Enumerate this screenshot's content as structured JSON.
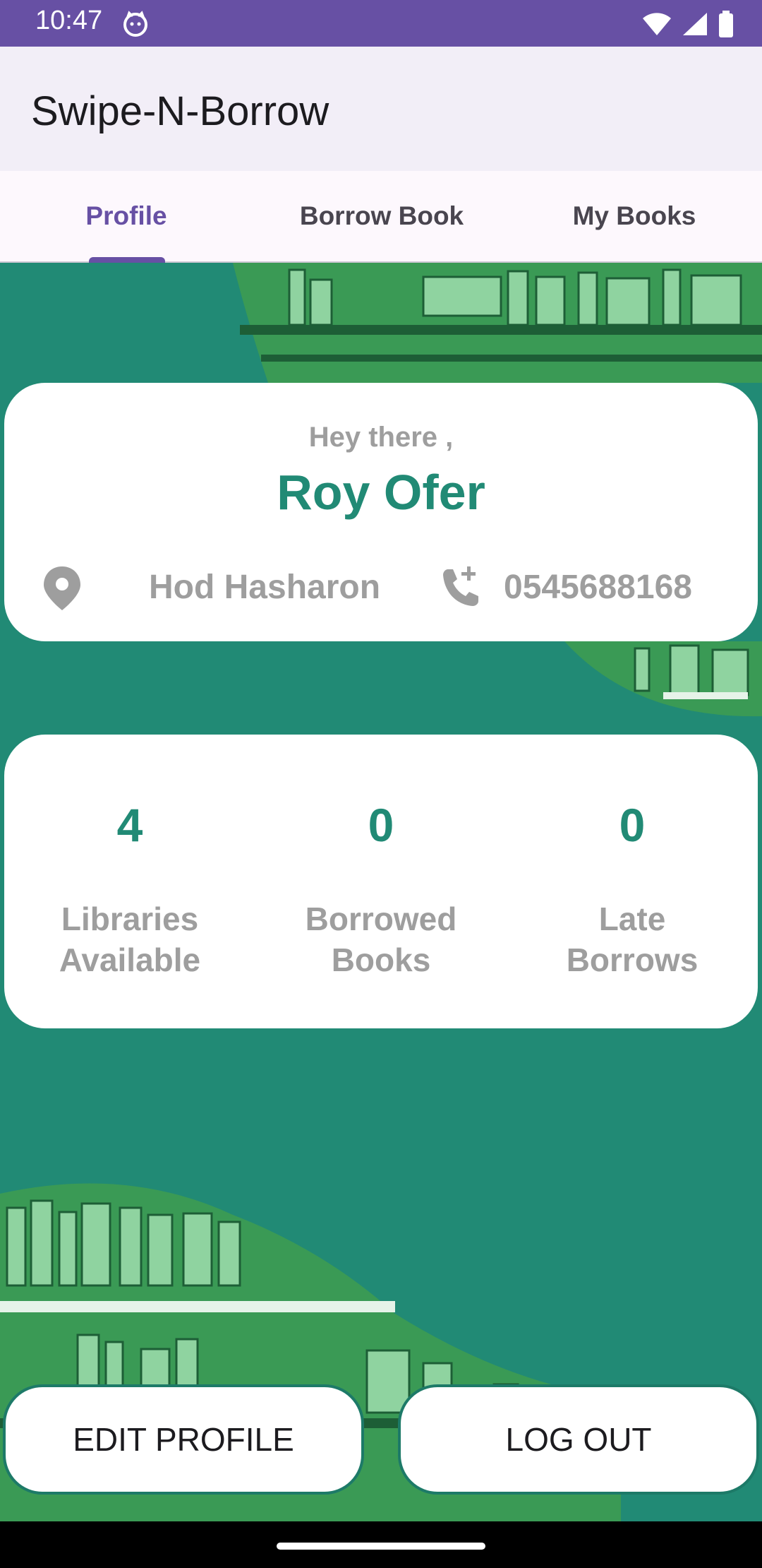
{
  "status_bar": {
    "time": "10:47"
  },
  "app_bar": {
    "title": "Swipe-N-Borrow"
  },
  "tabs": [
    {
      "label": "Profile",
      "active": true
    },
    {
      "label": "Borrow Book",
      "active": false
    },
    {
      "label": "My Books",
      "active": false
    }
  ],
  "profile": {
    "greeting": "Hey there ,",
    "name": "Roy Ofer",
    "location": "Hod Hasharon",
    "phone": "0545688168"
  },
  "stats": [
    {
      "value": "4",
      "label_line1": "Libraries",
      "label_line2": "Available"
    },
    {
      "value": "0",
      "label_line1": "Borrowed",
      "label_line2": "Books"
    },
    {
      "value": "0",
      "label_line1": "Late",
      "label_line2": "Borrows"
    }
  ],
  "buttons": {
    "edit_profile": "EDIT PROFILE",
    "log_out": "LOG OUT"
  },
  "colors": {
    "primary": "#6750a4",
    "teal": "#218a75",
    "label_gray": "#9e9e9e",
    "shelf_green": "#3a9a55"
  }
}
